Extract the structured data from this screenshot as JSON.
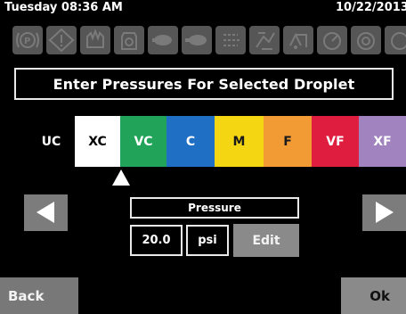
{
  "status": {
    "day_time": "Tuesday 08:36 AM",
    "date": "10/22/2013"
  },
  "title": "Enter Pressures For Selected Droplet",
  "droplets": [
    {
      "label": "UC",
      "bg": "#000000",
      "fg": "#ffffff"
    },
    {
      "label": "XC",
      "bg": "#ffffff",
      "fg": "#000000"
    },
    {
      "label": "VC",
      "bg": "#22a35a",
      "fg": "#ffffff"
    },
    {
      "label": "C",
      "bg": "#1f6fc4",
      "fg": "#ffffff"
    },
    {
      "label": "M",
      "bg": "#f4d712",
      "fg": "#1a1a1a"
    },
    {
      "label": "F",
      "bg": "#f29a33",
      "fg": "#1a1a1a"
    },
    {
      "label": "VF",
      "bg": "#df1e3f",
      "fg": "#ffffff"
    },
    {
      "label": "XF",
      "bg": "#a184bf",
      "fg": "#ffffff"
    }
  ],
  "selected_droplet": "XC",
  "pressure": {
    "label": "Pressure",
    "value": "20.0",
    "unit": "psi",
    "edit_label": "Edit"
  },
  "buttons": {
    "back": "Back",
    "ok": "Ok"
  },
  "icons": [
    "park-brake-icon",
    "warning-icon",
    "engine-icon",
    "tank-icon",
    "spray-icon",
    "nozzle-icon",
    "fan-icon",
    "boom-icon",
    "pump-icon",
    "gauge-icon",
    "alarm-icon"
  ],
  "colors": {
    "background": "#000000",
    "icon_button": "#565656",
    "button_gray": "#8a8a8a",
    "outline": "#e9e9e9"
  }
}
